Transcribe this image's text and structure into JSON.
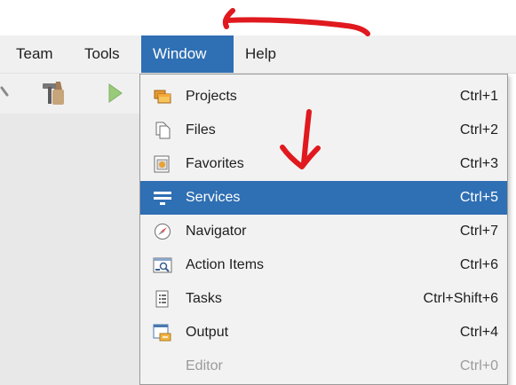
{
  "menubar": {
    "items": [
      {
        "label": "Team"
      },
      {
        "label": "Tools"
      },
      {
        "label": "Window",
        "active": true
      },
      {
        "label": "Help"
      }
    ]
  },
  "toolbar": {
    "icons": [
      "team-icon",
      "hammer-broom-icon",
      "run-play-icon"
    ]
  },
  "window_menu": {
    "items": [
      {
        "label": "Projects",
        "shortcut": "Ctrl+1",
        "icon": "projects-icon"
      },
      {
        "label": "Files",
        "shortcut": "Ctrl+2",
        "icon": "files-icon"
      },
      {
        "label": "Favorites",
        "shortcut": "Ctrl+3",
        "icon": "favorites-icon"
      },
      {
        "label": "Services",
        "shortcut": "Ctrl+5",
        "icon": "services-icon",
        "selected": true
      },
      {
        "label": "Navigator",
        "shortcut": "Ctrl+7",
        "icon": "navigator-icon"
      },
      {
        "label": "Action Items",
        "shortcut": "Ctrl+6",
        "icon": "action-items-icon"
      },
      {
        "label": "Tasks",
        "shortcut": "Ctrl+Shift+6",
        "icon": "tasks-icon"
      },
      {
        "label": "Output",
        "shortcut": "Ctrl+4",
        "icon": "output-icon"
      },
      {
        "label": "Editor",
        "shortcut": "Ctrl+0",
        "icon": "",
        "disabled": true
      }
    ]
  },
  "colors": {
    "highlight": "#2f6fb3",
    "annotation": "#e0191f",
    "menu_background": "#f2f2f2"
  }
}
